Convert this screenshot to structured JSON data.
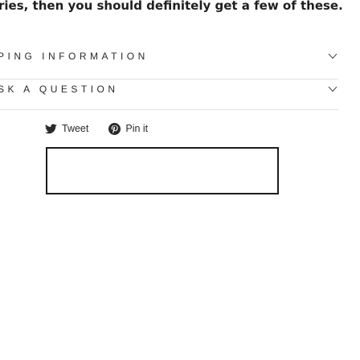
{
  "description": {
    "text": "ries, then you should definitely get a few of these."
  },
  "accordion": {
    "shipping_label": "PING INFORMATION",
    "question_label": "SK A QUESTION"
  },
  "share": {
    "tweet_label": "Tweet",
    "pin_label": "Pin it"
  },
  "icons": {
    "chevron": "chevron-down-icon",
    "twitter": "twitter-icon",
    "pinterest": "pinterest-icon"
  },
  "colors": {
    "text": "#2a2a2a",
    "divider": "#e2e2e2",
    "box_border": "#1c1c1c"
  }
}
